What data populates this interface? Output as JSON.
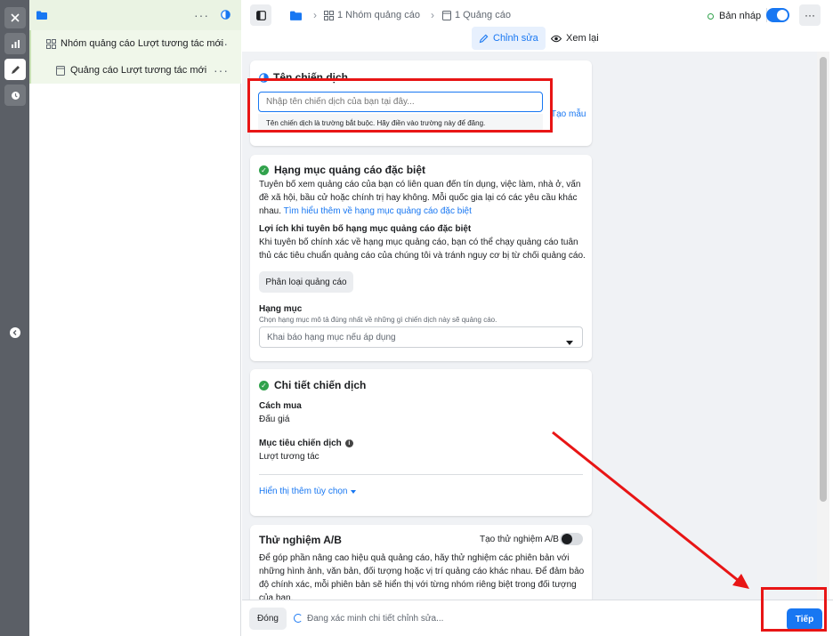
{
  "rail": {
    "close_icon": "close-icon",
    "chart_icon": "bar-chart-icon",
    "edit_icon": "pencil-icon",
    "history_icon": "clock-icon"
  },
  "tree": {
    "campaign_icon": "folder-icon",
    "adset_label": "Nhóm quảng cáo Lượt tương tác mới",
    "ad_label": "Quảng cáo Lượt tương tác mới",
    "more": "···"
  },
  "topbar": {
    "crumb_adsets": "1 Nhóm quảng cáo",
    "crumb_ads": "1 Quảng cáo",
    "draft_label": "Bản nháp",
    "more": "···"
  },
  "modes": {
    "edit": "Chỉnh sửa",
    "view": "Xem lại"
  },
  "campaign_name": {
    "title": "Tên chiến dịch",
    "placeholder": "Nhập tên chiến dịch của bạn tại đây...",
    "error": "Tên chiến dịch là trường bắt buộc. Hãy điền vào trường này để đăng.",
    "template_link": "Tạo mẫu"
  },
  "special_category": {
    "title": "Hạng mục quảng cáo đặc biệt",
    "desc": "Tuyên bố xem quảng cáo của bạn có liên quan đến tín dụng, việc làm, nhà ở, vấn đề xã hội, bầu cử hoặc chính trị hay không. Mỗi quốc gia lại có các yêu cầu khác nhau.",
    "learn_more": "Tìm hiểu thêm về hạng mục quảng cáo đặc biệt",
    "benefit_title": "Lợi ích khi tuyên bố hạng mục quảng cáo đặc biệt",
    "benefit_desc": "Khi tuyên bố chính xác về hạng mục quảng cáo, bạn có thể chạy quảng cáo tuân thủ các tiêu chuẩn quảng cáo của chúng tôi và tránh nguy cơ bị từ chối quảng cáo.",
    "classify_button": "Phân loại quảng cáo",
    "category_label": "Hạng mục",
    "category_hint": "Chọn hạng mục mô tả đúng nhất về những gì chiến dịch này sẽ quảng cáo.",
    "category_select": "Khai báo hạng mục nếu áp dụng"
  },
  "details": {
    "title": "Chi tiết chiến dịch",
    "buy_label": "Cách mua",
    "buy_value": "Đấu giá",
    "objective_label": "Mục tiêu chiến dịch",
    "objective_value": "Lượt tương tác",
    "more_options": "Hiển thị thêm tùy chọn"
  },
  "ab_test": {
    "title": "Thử nghiệm A/B",
    "toggle_label": "Tạo thử nghiệm A/B",
    "desc": "Để góp phần nâng cao hiệu quả quảng cáo, hãy thử nghiệm các phiên bản với những hình ảnh, văn bản, đối tượng hoặc vị trí quảng cáo khác nhau. Để đảm bảo độ chính xác, mỗi phiên bản sẽ hiển thị với từng nhóm riêng biệt trong đối tượng của bạn."
  },
  "bottom": {
    "close_button": "Đóng",
    "status": "Đang xác minh chi tiết chỉnh sửa...",
    "next_button": "Tiếp"
  },
  "colors": {
    "accent": "#1877f2",
    "success": "#31a24c",
    "annotation": "#e81515"
  }
}
